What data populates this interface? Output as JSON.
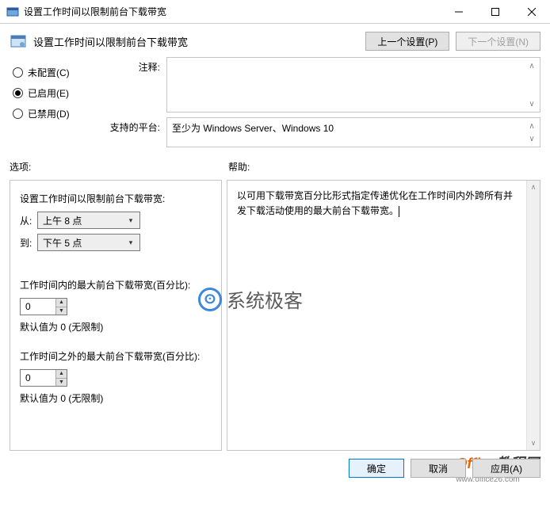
{
  "window": {
    "title": "设置工作时间以限制前台下载带宽"
  },
  "header": {
    "policy_title": "设置工作时间以限制前台下载带宽",
    "prev_btn": "上一个设置(P)",
    "next_btn": "下一个设置(N)"
  },
  "radios": {
    "not_configured": "未配置(C)",
    "enabled": "已启用(E)",
    "disabled": "已禁用(D)",
    "selected": "enabled"
  },
  "fields": {
    "comment_label": "注释:",
    "comment_value": "",
    "platform_label": "支持的平台:",
    "platform_value": "至少为 Windows Server、Windows 10"
  },
  "sections": {
    "options_label": "选项:",
    "help_label": "帮助:"
  },
  "options": {
    "title": "设置工作时间以限制前台下载带宽:",
    "from_label": "从:",
    "from_value": "上午 8 点",
    "to_label": "到:",
    "to_value": "下午 5 点",
    "in_hours_label": "工作时间内的最大前台下载带宽(百分比):",
    "in_hours_value": "0",
    "in_hours_hint": "默认值为 0 (无限制)",
    "out_hours_label": "工作时间之外的最大前台下载带宽(百分比):",
    "out_hours_value": "0",
    "out_hours_hint": "默认值为 0 (无限制)"
  },
  "help": {
    "text": "以可用下载带宽百分比形式指定传递优化在工作时间内外跨所有并发下载活动使用的最大前台下载带宽。"
  },
  "watermark1": "系统极客",
  "watermark2": {
    "brand1": "Office",
    "brand2": "教程网",
    "url": "www.office26.com"
  },
  "footer": {
    "ok": "确定",
    "cancel": "取消",
    "apply": "应用(A)"
  }
}
